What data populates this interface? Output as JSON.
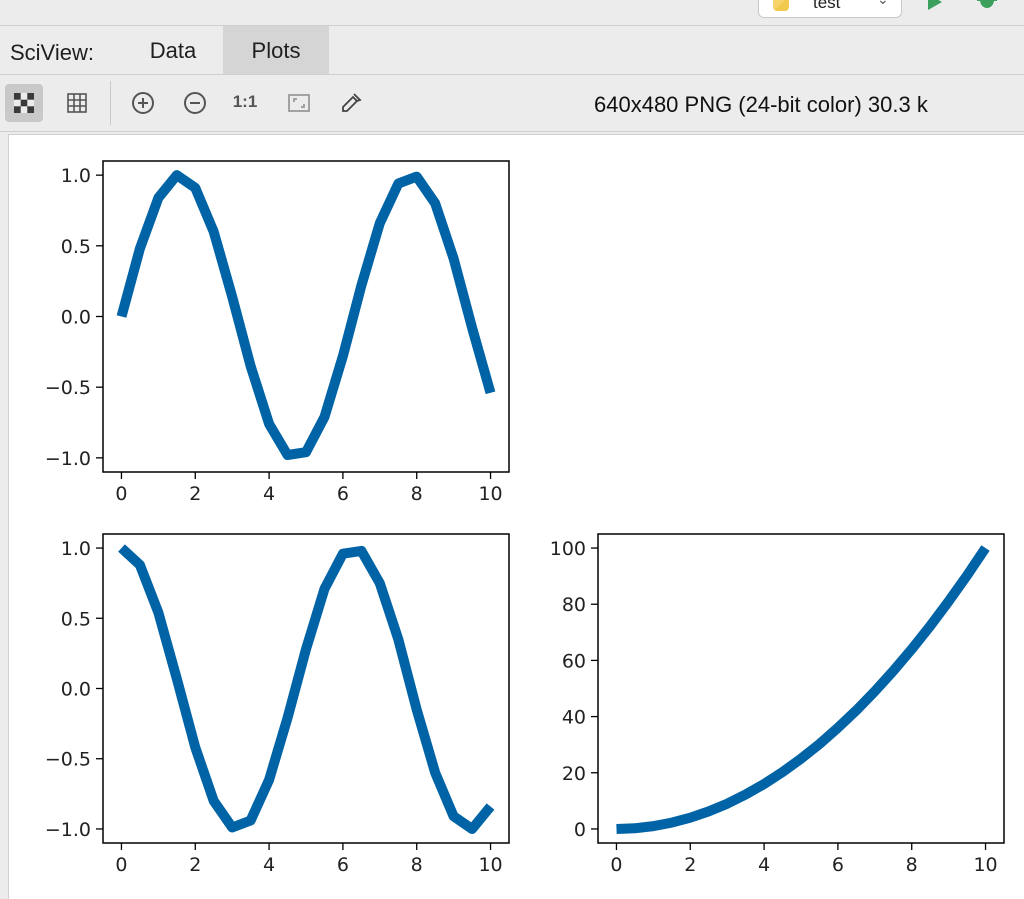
{
  "run_config": {
    "name": "test"
  },
  "tab_bar": {
    "title": "SciView:",
    "tabs": [
      {
        "label": "Data",
        "active": false
      },
      {
        "label": "Plots",
        "active": true
      }
    ]
  },
  "toolbar": {
    "buttons": [
      "checkerboard-icon",
      "grid-icon",
      "zoom-in-icon",
      "zoom-out-icon",
      "actual-size-icon",
      "fit-window-icon",
      "color-picker-icon"
    ],
    "actual_size_label": "1:1",
    "image_info": "640x480 PNG (24-bit color) 30.3 k"
  },
  "colors": {
    "line": "#0063a6",
    "accent_tab": "#d5d5d5",
    "run": "#3aa05b"
  },
  "chart_data": [
    {
      "type": "line",
      "function": "sin(x)",
      "x": [
        0,
        0.5,
        1,
        1.5,
        2,
        2.5,
        3,
        3.5,
        4,
        4.5,
        5,
        5.5,
        6,
        6.5,
        7,
        7.5,
        8,
        8.5,
        9,
        9.5,
        10
      ],
      "y": [
        0,
        0.48,
        0.84,
        1.0,
        0.91,
        0.6,
        0.14,
        -0.35,
        -0.76,
        -0.98,
        -0.96,
        -0.71,
        -0.28,
        0.22,
        0.66,
        0.94,
        0.99,
        0.8,
        0.41,
        -0.08,
        -0.54
      ],
      "xlim": [
        -0.5,
        10.5
      ],
      "ylim": [
        -1.1,
        1.1
      ],
      "xticks": [
        "0",
        "2",
        "4",
        "6",
        "8",
        "10"
      ],
      "yticks": [
        "1.0",
        "0.5",
        "0.0",
        "−0.5",
        "−1.0"
      ],
      "grid": false
    },
    {
      "type": "line",
      "function": "cos(x)",
      "x": [
        0,
        0.5,
        1,
        1.5,
        2,
        2.5,
        3,
        3.5,
        4,
        4.5,
        5,
        5.5,
        6,
        6.5,
        7,
        7.5,
        8,
        8.5,
        9,
        9.5,
        10
      ],
      "y": [
        1.0,
        0.88,
        0.54,
        0.07,
        -0.42,
        -0.8,
        -0.99,
        -0.94,
        -0.65,
        -0.21,
        0.28,
        0.71,
        0.96,
        0.98,
        0.75,
        0.35,
        -0.15,
        -0.6,
        -0.91,
        -1.0,
        -0.84
      ],
      "xlim": [
        -0.5,
        10.5
      ],
      "ylim": [
        -1.1,
        1.1
      ],
      "xticks": [
        "0",
        "2",
        "4",
        "6",
        "8",
        "10"
      ],
      "yticks": [
        "1.0",
        "0.5",
        "0.0",
        "−0.5",
        "−1.0"
      ],
      "grid": false
    },
    {
      "type": "line",
      "function": "x^2",
      "x": [
        0,
        0.5,
        1,
        1.5,
        2,
        2.5,
        3,
        3.5,
        4,
        4.5,
        5,
        5.5,
        6,
        6.5,
        7,
        7.5,
        8,
        8.5,
        9,
        9.5,
        10
      ],
      "y": [
        0,
        0.25,
        1,
        2.25,
        4,
        6.25,
        9,
        12.25,
        16,
        20.25,
        25,
        30.25,
        36,
        42.25,
        49,
        56.25,
        64,
        72.25,
        81,
        90.25,
        100
      ],
      "xlim": [
        -0.5,
        10.5
      ],
      "ylim": [
        -5,
        105
      ],
      "xticks": [
        "0",
        "2",
        "4",
        "6",
        "8",
        "10"
      ],
      "yticks": [
        "100",
        "80",
        "60",
        "40",
        "20",
        "0"
      ],
      "grid": false
    }
  ]
}
